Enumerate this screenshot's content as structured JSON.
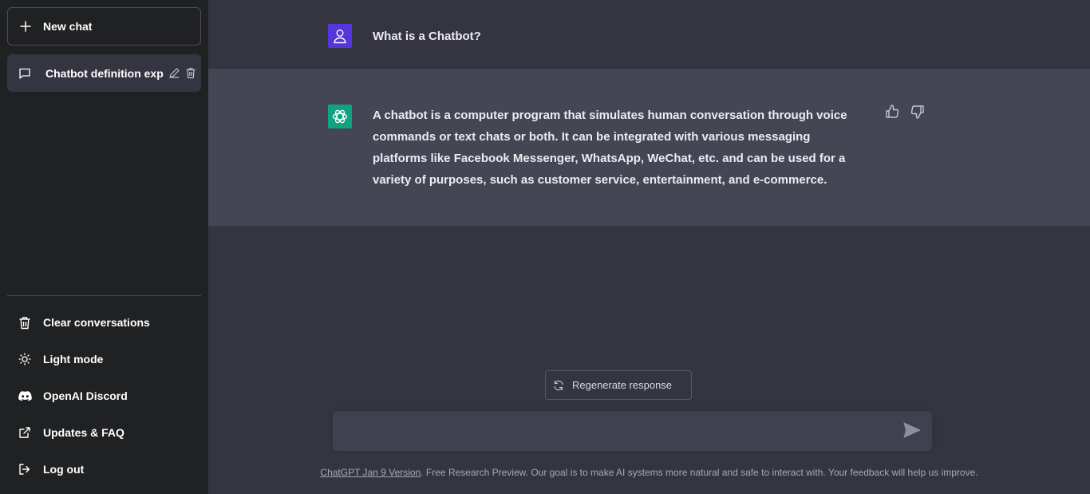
{
  "sidebar": {
    "new_chat_label": "New chat",
    "conversations": [
      {
        "title": "Chatbot definition explanation"
      }
    ],
    "menu": [
      {
        "label": "Clear conversations",
        "icon": "trash-icon"
      },
      {
        "label": "Light mode",
        "icon": "sun-icon"
      },
      {
        "label": "OpenAI Discord",
        "icon": "discord-icon"
      },
      {
        "label": "Updates & FAQ",
        "icon": "external-link-icon"
      },
      {
        "label": "Log out",
        "icon": "logout-icon"
      }
    ]
  },
  "thread": {
    "user_message": "What is a Chatbot?",
    "assistant_message": "A chatbot is a computer program that simulates human conversation through voice commands or text chats or both. It can be integrated with various messaging platforms like Facebook Messenger, WhatsApp, WeChat, etc. and can be used for a variety of purposes, such as customer service, entertainment, and e-commerce."
  },
  "composer": {
    "regenerate_label": "Regenerate response",
    "input_value": ""
  },
  "footer": {
    "version_link": "ChatGPT Jan 9 Version",
    "text": ". Free Research Preview. Our goal is to make AI systems more natural and safe to interact with. Your feedback will help us improve."
  },
  "colors": {
    "sidebar_bg": "#202123",
    "main_bg": "#343541",
    "assistant_row_bg": "#444654",
    "user_avatar": "#5436da",
    "assistant_avatar": "#10a37f"
  }
}
